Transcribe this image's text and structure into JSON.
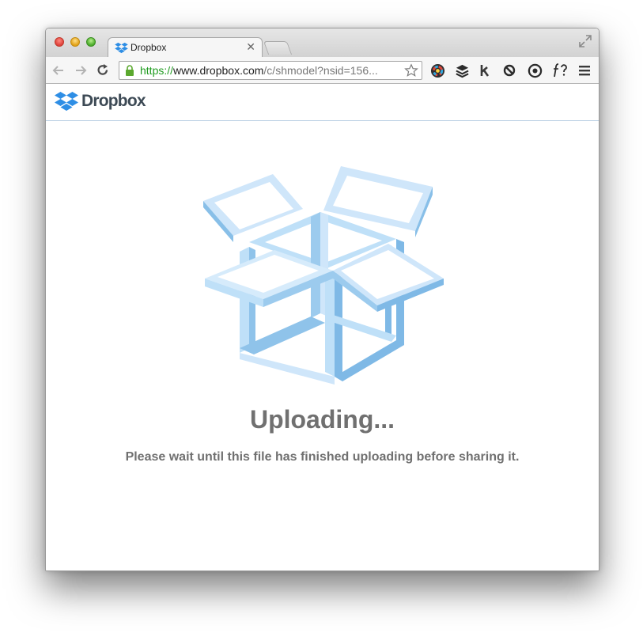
{
  "browser": {
    "tab": {
      "title": "Dropbox"
    },
    "address_bar": {
      "scheme": "https",
      "separator": "://",
      "host": "www.dropbox.com",
      "path": "/c/shmodel?nsid=156..."
    }
  },
  "site": {
    "logo_text": "Dropbox",
    "accent_color": "#2e8ee5"
  },
  "main": {
    "title": "Uploading...",
    "message": "Please wait until this file has finished uploading before sharing it."
  },
  "icons": {
    "window_controls": [
      "close-icon",
      "minimize-icon",
      "zoom-icon"
    ],
    "toolbar": [
      "back-arrow-icon",
      "forward-arrow-icon",
      "reload-icon",
      "lock-icon",
      "star-icon"
    ],
    "extensions": [
      "color-picker-icon",
      "buffer-icon",
      "k-icon",
      "sync-icon",
      "gear-icon",
      "font-icon",
      "menu-icon"
    ],
    "illustration": "open-box-icon"
  }
}
